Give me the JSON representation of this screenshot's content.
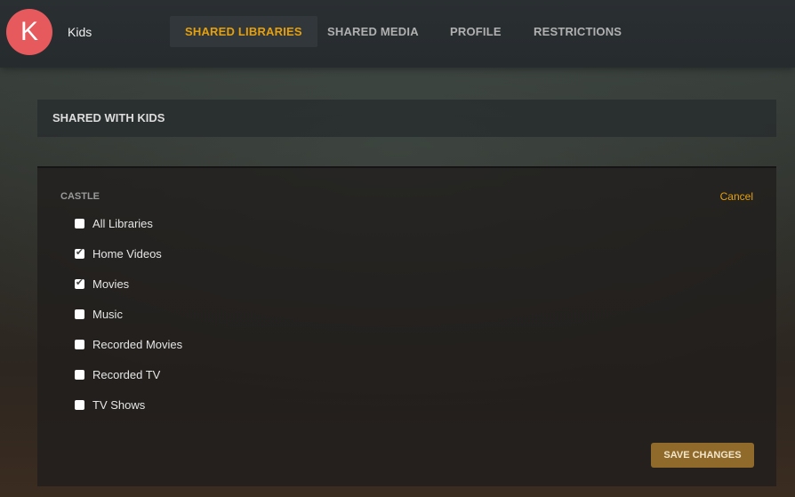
{
  "header": {
    "avatar_letter": "K",
    "username": "Kids",
    "tabs": [
      {
        "label": "SHARED LIBRARIES",
        "active": true
      },
      {
        "label": "SHARED MEDIA",
        "active": false
      },
      {
        "label": "PROFILE",
        "active": false
      },
      {
        "label": "RESTRICTIONS",
        "active": false
      }
    ]
  },
  "section": {
    "title": "SHARED WITH KIDS"
  },
  "server": {
    "name": "CASTLE",
    "cancel_label": "Cancel",
    "libraries": [
      {
        "label": "All Libraries",
        "checked": false
      },
      {
        "label": "Home Videos",
        "checked": true
      },
      {
        "label": "Movies",
        "checked": true
      },
      {
        "label": "Music",
        "checked": false
      },
      {
        "label": "Recorded Movies",
        "checked": false
      },
      {
        "label": "Recorded TV",
        "checked": false
      },
      {
        "label": "TV Shows",
        "checked": false
      }
    ],
    "save_label": "SAVE CHANGES"
  },
  "colors": {
    "accent": "#e5a00d",
    "avatar": "#e65a5d",
    "save_button": "#8f6a2a"
  },
  "icons": {
    "check": "check-icon"
  }
}
